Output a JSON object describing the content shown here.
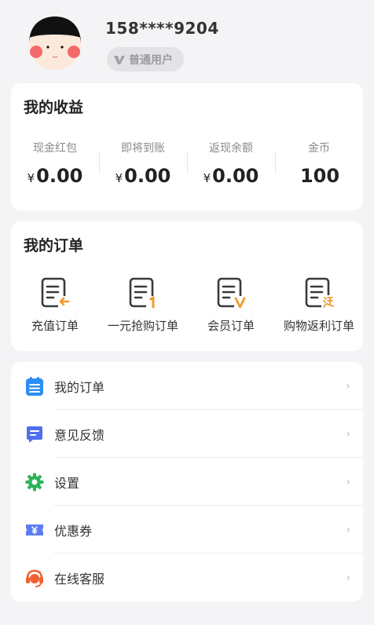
{
  "profile": {
    "phone": "158****9204",
    "badge": "普通用户"
  },
  "earnings": {
    "title": "我的收益",
    "items": [
      {
        "label": "现金红包",
        "currency": "¥",
        "value": "0.00"
      },
      {
        "label": "即将到账",
        "currency": "¥",
        "value": "0.00"
      },
      {
        "label": "返现余额",
        "currency": "¥",
        "value": "0.00"
      },
      {
        "label": "金币",
        "currency": "",
        "value": "100"
      }
    ]
  },
  "orders": {
    "title": "我的订单",
    "items": [
      {
        "label": "充值订单",
        "icon": "recharge-order-icon"
      },
      {
        "label": "一元抢购订单",
        "icon": "flash-sale-order-icon"
      },
      {
        "label": "会员订单",
        "icon": "vip-order-icon"
      },
      {
        "label": "购物返利订单",
        "icon": "rebate-order-icon"
      }
    ]
  },
  "menu": {
    "items": [
      {
        "label": "我的订单",
        "icon": "order-list-icon",
        "color": "#2b8ef5"
      },
      {
        "label": "意见反馈",
        "icon": "feedback-icon",
        "color": "#4f6ff0"
      },
      {
        "label": "设置",
        "icon": "gear-icon",
        "color": "#2db45a"
      },
      {
        "label": "优惠券",
        "icon": "coupon-icon",
        "color": "#5b7cf3"
      },
      {
        "label": "在线客服",
        "icon": "customer-service-icon",
        "color": "#f06030"
      }
    ]
  },
  "colors": {
    "accent_orange": "#f39a2c",
    "icon_dark": "#3a3a3c"
  }
}
